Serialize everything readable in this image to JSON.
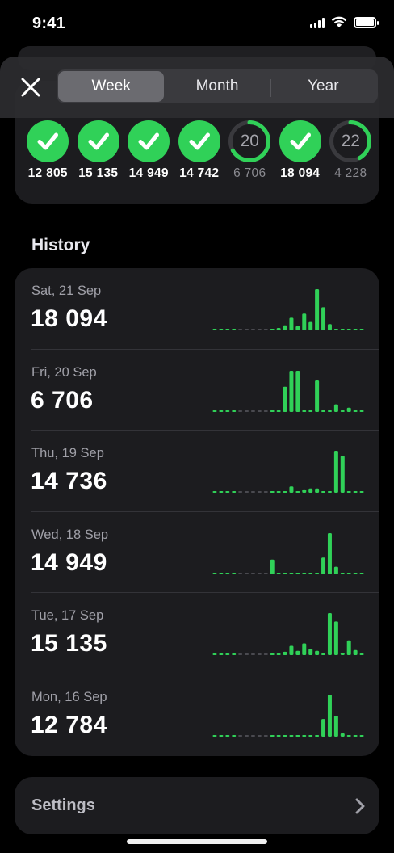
{
  "status_bar": {
    "time": "9:41"
  },
  "nav": {
    "segments": [
      "Week",
      "Month",
      "Year"
    ],
    "selected_index": 0
  },
  "week": {
    "days": [
      {
        "steps": "12 805",
        "goal_met": true,
        "progress": 1.0,
        "label": ""
      },
      {
        "steps": "15 135",
        "goal_met": true,
        "progress": 1.0,
        "label": ""
      },
      {
        "steps": "14 949",
        "goal_met": true,
        "progress": 1.0,
        "label": ""
      },
      {
        "steps": "14 742",
        "goal_met": true,
        "progress": 1.0,
        "label": ""
      },
      {
        "steps": "6 706",
        "goal_met": false,
        "progress": 0.67,
        "label": "20"
      },
      {
        "steps": "18 094",
        "goal_met": true,
        "progress": 1.0,
        "label": ""
      },
      {
        "steps": "4 228",
        "goal_met": false,
        "progress": 0.42,
        "label": "22"
      }
    ]
  },
  "history": {
    "title": "History",
    "rows": [
      {
        "date": "Sat, 21 Sep",
        "steps": "18 094",
        "bars": [
          0,
          0,
          0,
          0,
          0,
          0,
          0,
          0,
          0,
          0,
          0.05,
          0.12,
          0.3,
          0.1,
          0.4,
          0.2,
          0.98,
          0.55,
          0.15,
          0,
          0,
          0,
          0,
          0
        ]
      },
      {
        "date": "Fri, 20 Sep",
        "steps": "6 706",
        "bars": [
          0,
          0,
          0,
          0,
          0,
          0,
          0,
          0,
          0,
          0,
          0,
          0.6,
          0.98,
          0.98,
          0,
          0,
          0.75,
          0,
          0,
          0.18,
          0,
          0.1,
          0,
          0
        ]
      },
      {
        "date": "Thu, 19 Sep",
        "steps": "14 736",
        "bars": [
          0,
          0,
          0,
          0,
          0,
          0,
          0,
          0,
          0,
          0,
          0,
          0,
          0.15,
          0,
          0.08,
          0.1,
          0.1,
          0,
          0,
          1.0,
          0.88,
          0,
          0,
          0
        ]
      },
      {
        "date": "Wed, 18 Sep",
        "steps": "14 949",
        "bars": [
          0,
          0,
          0,
          0,
          0,
          0,
          0,
          0,
          0,
          0.35,
          0,
          0,
          0,
          0,
          0,
          0,
          0,
          0.4,
          0.98,
          0.18,
          0,
          0,
          0,
          0
        ]
      },
      {
        "date": "Tue, 17 Sep",
        "steps": "15 135",
        "bars": [
          0,
          0,
          0,
          0,
          0,
          0,
          0,
          0,
          0,
          0,
          0,
          0.08,
          0.22,
          0.1,
          0.28,
          0.15,
          0.1,
          0,
          1.0,
          0.8,
          0.05,
          0.35,
          0.12,
          0
        ]
      },
      {
        "date": "Mon, 16 Sep",
        "steps": "12 784",
        "bars": [
          0,
          0,
          0,
          0,
          0,
          0,
          0,
          0,
          0,
          0,
          0,
          0,
          0,
          0,
          0,
          0,
          0,
          0.42,
          1.0,
          0.5,
          0.08,
          0,
          0,
          0
        ]
      }
    ]
  },
  "settings": {
    "label": "Settings"
  },
  "colors": {
    "accent": "#30d158",
    "card": "#1c1c1f",
    "inactive": "#3a3a3e"
  }
}
